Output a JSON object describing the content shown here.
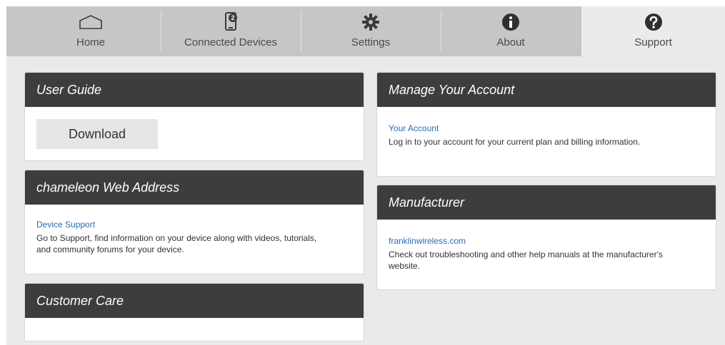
{
  "nav": {
    "tabs": [
      {
        "label": "Home",
        "icon": "home-icon"
      },
      {
        "label": "Connected Devices",
        "icon": "connected-devices-icon",
        "badge": "2"
      },
      {
        "label": "Settings",
        "icon": "gear-icon"
      },
      {
        "label": "About",
        "icon": "info-icon"
      },
      {
        "label": "Support",
        "icon": "question-icon"
      }
    ],
    "active": "Support"
  },
  "user_guide": {
    "title": "User Guide",
    "download_label": "Download"
  },
  "web_address": {
    "title": "chameleon Web Address",
    "link": "Device Support",
    "description": "Go to Support, find information on your device along with videos, tutorials, and community forums for your device."
  },
  "customer_care": {
    "title": "Customer Care"
  },
  "account": {
    "title": "Manage Your Account",
    "link": "Your Account",
    "description": "Log in to your account for your current plan and billing information."
  },
  "manufacturer": {
    "title": "Manufacturer",
    "link": "franklinwireless.com",
    "description": "Check out troubleshooting and other help manuals at the manufacturer's website."
  },
  "colors": {
    "header_bg": "#3d3d3d",
    "nav_bg": "#c6c6c6",
    "link": "#2a6bb0"
  }
}
